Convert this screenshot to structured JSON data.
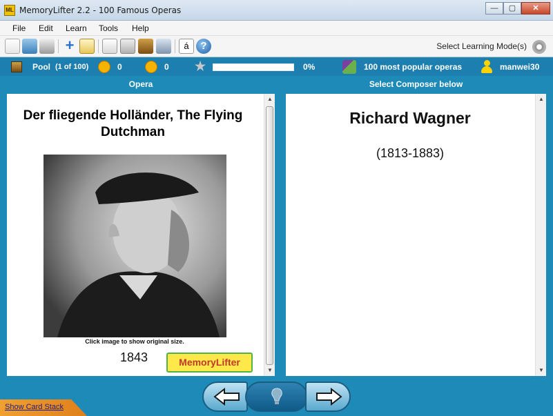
{
  "window": {
    "title": "MemoryLifter 2.2 - 100 Famous Operas",
    "app_icon_text": "ML"
  },
  "menu": [
    "File",
    "Edit",
    "Learn",
    "Tools",
    "Help"
  ],
  "toolbar": {
    "mode_label": "Select Learning Mode(s)",
    "accent_char_button": "á"
  },
  "status": {
    "pool_label": "Pool",
    "pool_count": "(1 of 100)",
    "correct_count": "0",
    "wrong_count": "0",
    "progress_percent": "0%",
    "progress_value": 0,
    "deck_name": "100 most popular operas",
    "user_name": "manwei30"
  },
  "question": {
    "header": "Opera",
    "title": "Der fliegende Holländer, The Flying Dutchman",
    "image_hint": "Click image to show original size.",
    "year": "1843",
    "logo_text": "MemoryLifter"
  },
  "answer": {
    "header": "Select Composer below",
    "title": "Richard Wagner",
    "subtitle": "(1813-1883)"
  },
  "footer": {
    "card_stack_link": "Show Card Stack"
  },
  "colors": {
    "background": "#1e8ab8",
    "status_bar": "#1c7fb0",
    "progress_fill": "#4caf50"
  }
}
